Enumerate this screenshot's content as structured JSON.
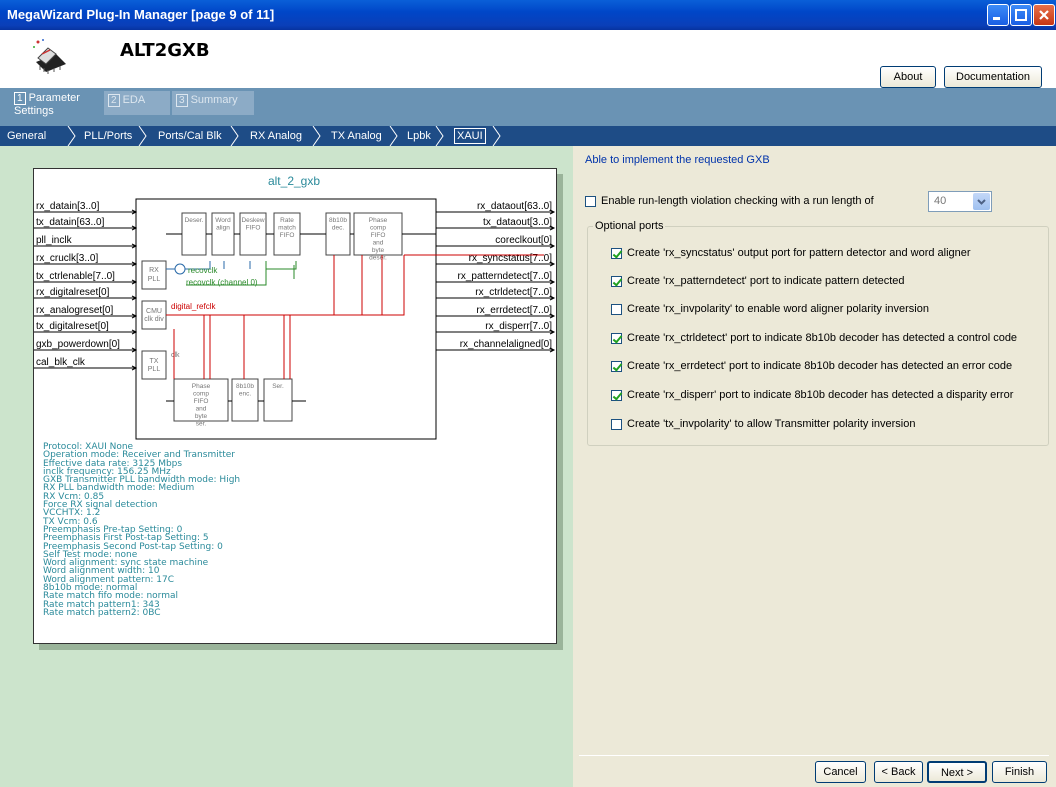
{
  "window": {
    "title": "MegaWizard Plug-In Manager [page 9 of 11]"
  },
  "header": {
    "app_name": "ALT2GXB",
    "about_label": "About",
    "documentation_label": "Documentation"
  },
  "steps": [
    {
      "num": "1",
      "label": "Parameter Settings"
    },
    {
      "num": "2",
      "label": "EDA"
    },
    {
      "num": "3",
      "label": "Summary"
    }
  ],
  "breadcrumb": [
    "General",
    "PLL/Ports",
    "Ports/Cal Blk",
    "RX Analog",
    "TX Analog",
    "Lpbk",
    "XAUI"
  ],
  "diagram": {
    "title": "alt_2_gxb",
    "inputs": [
      "rx_datain[3..0]",
      "tx_datain[63..0]",
      "pll_inclk",
      "rx_cruclk[3..0]",
      "tx_ctrlenable[7..0]",
      "rx_digitalreset[0]",
      "rx_analogreset[0]",
      "tx_digitalreset[0]",
      "gxb_powerdown[0]",
      "cal_blk_clk"
    ],
    "outputs": [
      "rx_dataout[63..0]",
      "tx_dataout[3..0]",
      "coreclkout[0]",
      "rx_syncstatus[7..0]",
      "rx_patterndetect[7..0]",
      "rx_ctrldetect[7..0]",
      "rx_errdetect[7..0]",
      "rx_disperr[7..0]",
      "rx_channelaligned[0]"
    ],
    "rx_blocks": [
      "Deser.",
      "Word align",
      "Deskew FIFO",
      "Rate match FIFO",
      "8b10b dec.",
      "Phase comp FIFO and byte deser."
    ],
    "tx_blocks": [
      "Phase comp FIFO and byte ser.",
      "8b10b enc.",
      "Ser."
    ],
    "rx_pll": "RX PLL",
    "cmu": "CMU clk div",
    "tx_pll": "TX PLL",
    "recovclk": "recovclk",
    "recovclk_ch0": "recovclk (channel 0)",
    "digital_refclk": "digital_refclk",
    "clk": "clk",
    "info_lines": [
      "Protocol: XAUI None",
      "Operation mode: Receiver and Transmitter",
      "Effective data rate: 3125 Mbps",
      "inclk frequency: 156.25 MHz",
      "GXB Transmitter PLL bandwidth mode: High",
      "RX PLL bandwidth mode: Medium",
      "RX Vcm: 0.85",
      "Force RX signal detection",
      "VCCHTX: 1.2",
      "TX Vcm: 0.6",
      "Preemphasis Pre-tap Setting: 0",
      "Preemphasis First Post-tap Setting: 5",
      "Preemphasis Second Post-tap Setting: 0",
      "Self Test mode: none",
      "Word alignment: sync state machine",
      "Word alignment width: 10",
      "Word alignment pattern: 17C",
      "8b10b mode: normal",
      "Rate match fifo mode: normal",
      "Rate match pattern1: 343",
      "Rate match pattern2: 0BC"
    ]
  },
  "settings": {
    "status": "Able to implement the requested GXB",
    "runlength_label": "Enable run-length violation checking with a run length of",
    "runlength_checked": false,
    "runlength_value": "40",
    "group_title": "Optional ports",
    "options": [
      {
        "label": "Create 'rx_syncstatus' output port for pattern detector and word aligner",
        "checked": true
      },
      {
        "label": "Create 'rx_patterndetect' port to indicate pattern detected",
        "checked": true
      },
      {
        "label": "Create 'rx_invpolarity' to enable word aligner polarity inversion",
        "checked": false
      },
      {
        "label": "Create 'rx_ctrldetect' port to indicate 8b10b decoder has detected a control code",
        "checked": true
      },
      {
        "label": "Create 'rx_errdetect' port to indicate 8b10b decoder has detected an error code",
        "checked": true
      },
      {
        "label": "Create 'rx_disperr' port to indicate 8b10b decoder has detected a disparity error",
        "checked": true
      },
      {
        "label": "Create 'tx_invpolarity' to allow Transmitter polarity inversion",
        "checked": false
      }
    ]
  },
  "footer": {
    "cancel": "Cancel",
    "back": "< Back",
    "next": "Next >",
    "finish": "Finish"
  },
  "colors": {
    "titlebar": "#0046c8",
    "left_panel": "#cce4cc",
    "breadcrumb_bar": "#1e4c86",
    "steps_bar": "#6a93b4",
    "signal_red": "#cc0000",
    "signal_green": "#2a8a2a",
    "signal_blue": "#2a6aa8"
  }
}
